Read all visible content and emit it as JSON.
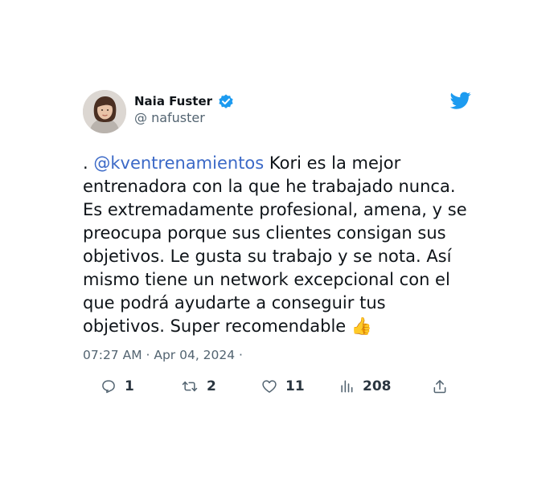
{
  "tweet": {
    "display_name": "Naia Fuster",
    "handle": "@ nafuster",
    "text_prefix": ". ",
    "mention": "@kventrenamientos",
    "text_body": " Kori es la mejor entrenadora con la que he trabajado nunca. Es extremadamente profesional, amena, y se preocupa porque sus clientes consigan sus objetivos. Le gusta su trabajo y se nota. Así mismo tiene un network excepcional con el que podrá ayudarte a conseguir tus objetivos. Super recomendable 👍",
    "timestamp": "07:27 AM · Apr 04, 2024 ·",
    "verified_icon": "verified-badge-icon",
    "brand_icon": "twitter-bird-icon",
    "colors": {
      "accent": "#1d9bf0",
      "mention": "#3b69c7",
      "muted": "#536471"
    }
  },
  "actions": {
    "reply": {
      "icon": "reply-icon",
      "count": "1"
    },
    "retweet": {
      "icon": "retweet-icon",
      "count": "2"
    },
    "like": {
      "icon": "heart-icon",
      "count": "11"
    },
    "views": {
      "icon": "views-icon",
      "count": "208"
    },
    "share": {
      "icon": "share-icon"
    }
  }
}
